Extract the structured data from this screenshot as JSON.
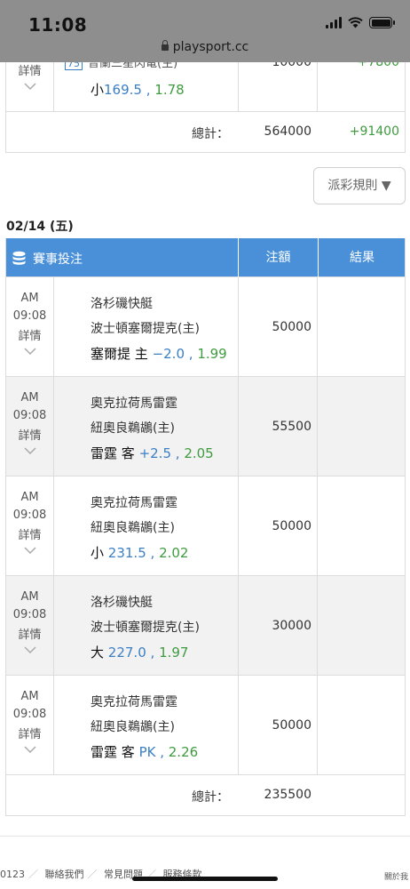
{
  "status_bar": {
    "time": "11:08",
    "url": "playsport.cc"
  },
  "prev_table": {
    "partial_row": {
      "detail": "詳情",
      "team_code": "75",
      "team_partial": "普蘭三星閃電(主)",
      "amount_partial": "10000",
      "result_partial": "+7800",
      "pick_label": "小",
      "pick_line": "169.5",
      "pick_sep": " , ",
      "pick_odds": "1.78"
    },
    "total_label": "總計：",
    "total_amount": "564000",
    "total_result": "+91400"
  },
  "rules_button": "派彩規則 ▼",
  "date": "02/14 (五)",
  "table": {
    "headers": {
      "bet": "賽事投注",
      "amount": "注額",
      "result": "結果"
    },
    "rows": [
      {
        "ampm": "AM",
        "time": "09:08",
        "detail": "詳情",
        "away": "洛杉磯快艇",
        "home": "波士頓塞爾提克(主)",
        "pick_team": "塞爾提 主",
        "pick_line": "−2.0",
        "pick_sep": " , ",
        "pick_odds": "1.99",
        "amount": "50000",
        "result": ""
      },
      {
        "ampm": "AM",
        "time": "09:08",
        "detail": "詳情",
        "away": "奧克拉荷馬雷霆",
        "home": "紐奧良鵜鶘(主)",
        "pick_team": "雷霆 客",
        "pick_line": "+2.5",
        "pick_sep": " , ",
        "pick_odds": "2.05",
        "amount": "55500",
        "result": ""
      },
      {
        "ampm": "AM",
        "time": "09:08",
        "detail": "詳情",
        "away": "奧克拉荷馬雷霆",
        "home": "紐奧良鵜鶘(主)",
        "pick_team": "小",
        "pick_line": "231.5",
        "pick_sep": " , ",
        "pick_odds": "2.02",
        "amount": "50000",
        "result": ""
      },
      {
        "ampm": "AM",
        "time": "09:08",
        "detail": "詳情",
        "away": "洛杉磯快艇",
        "home": "波士頓塞爾提克(主)",
        "pick_team": "大",
        "pick_line": "227.0",
        "pick_sep": " , ",
        "pick_odds": "1.97",
        "amount": "30000",
        "result": ""
      },
      {
        "ampm": "AM",
        "time": "09:08",
        "detail": "詳情",
        "away": "奧克拉荷馬雷霆",
        "home": "紐奧良鵜鶘(主)",
        "pick_team": "雷霆 客",
        "pick_line": "PK",
        "pick_sep": " , ",
        "pick_odds": "2.26",
        "amount": "50000",
        "result": ""
      }
    ],
    "total_label": "總計：",
    "total_amount": "235500"
  },
  "footer": {
    "code": "0123",
    "links": [
      "聯絡我們",
      "常見問題",
      "服務條款"
    ],
    "right": "關於我"
  },
  "colors": {
    "header_blue": "#4a90d9",
    "line_blue": "#3b7fc4",
    "odds_green": "#3f9b3f"
  }
}
